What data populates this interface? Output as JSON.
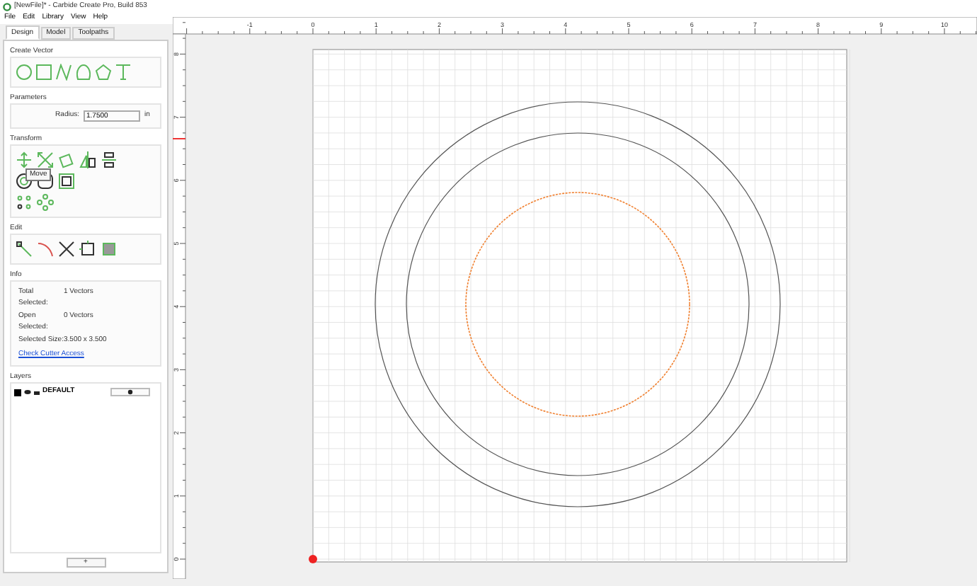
{
  "window": {
    "title": "[NewFile]* - Carbide Create Pro, Build 853"
  },
  "menu": [
    "File",
    "Edit",
    "Library",
    "View",
    "Help"
  ],
  "tabs": [
    {
      "label": "Design",
      "selected": true
    },
    {
      "label": "Model",
      "selected": false
    },
    {
      "label": "Toolpaths",
      "selected": false
    }
  ],
  "create_vector": {
    "title": "Create Vector"
  },
  "parameters": {
    "title": "Parameters",
    "label": "Radius:",
    "value": "1.7500",
    "unit": "in"
  },
  "transform": {
    "title": "Transform",
    "tooltip": "Move"
  },
  "edit": {
    "title": "Edit"
  },
  "info": {
    "title": "Info",
    "rows": [
      {
        "label": "Total Selected:",
        "value": "1 Vectors"
      },
      {
        "label": "Open Selected:",
        "value": "0 Vectors"
      },
      {
        "label": "Selected Size:",
        "value": "3.500 x 3.500"
      }
    ],
    "link": "Check Cutter Access"
  },
  "layers": {
    "title": "Layers",
    "items": [
      {
        "name": "DEFAULT",
        "color": "#000000"
      }
    ],
    "add_button": "+"
  },
  "ruler": {
    "x_labels": [
      "-1",
      "0",
      "1",
      "2",
      "3",
      "4",
      "5",
      "6",
      "7",
      "8",
      "9",
      "10"
    ],
    "y_labels": [
      "8",
      "7",
      "6",
      "5",
      "4",
      "3",
      "2",
      "1",
      "0"
    ]
  }
}
